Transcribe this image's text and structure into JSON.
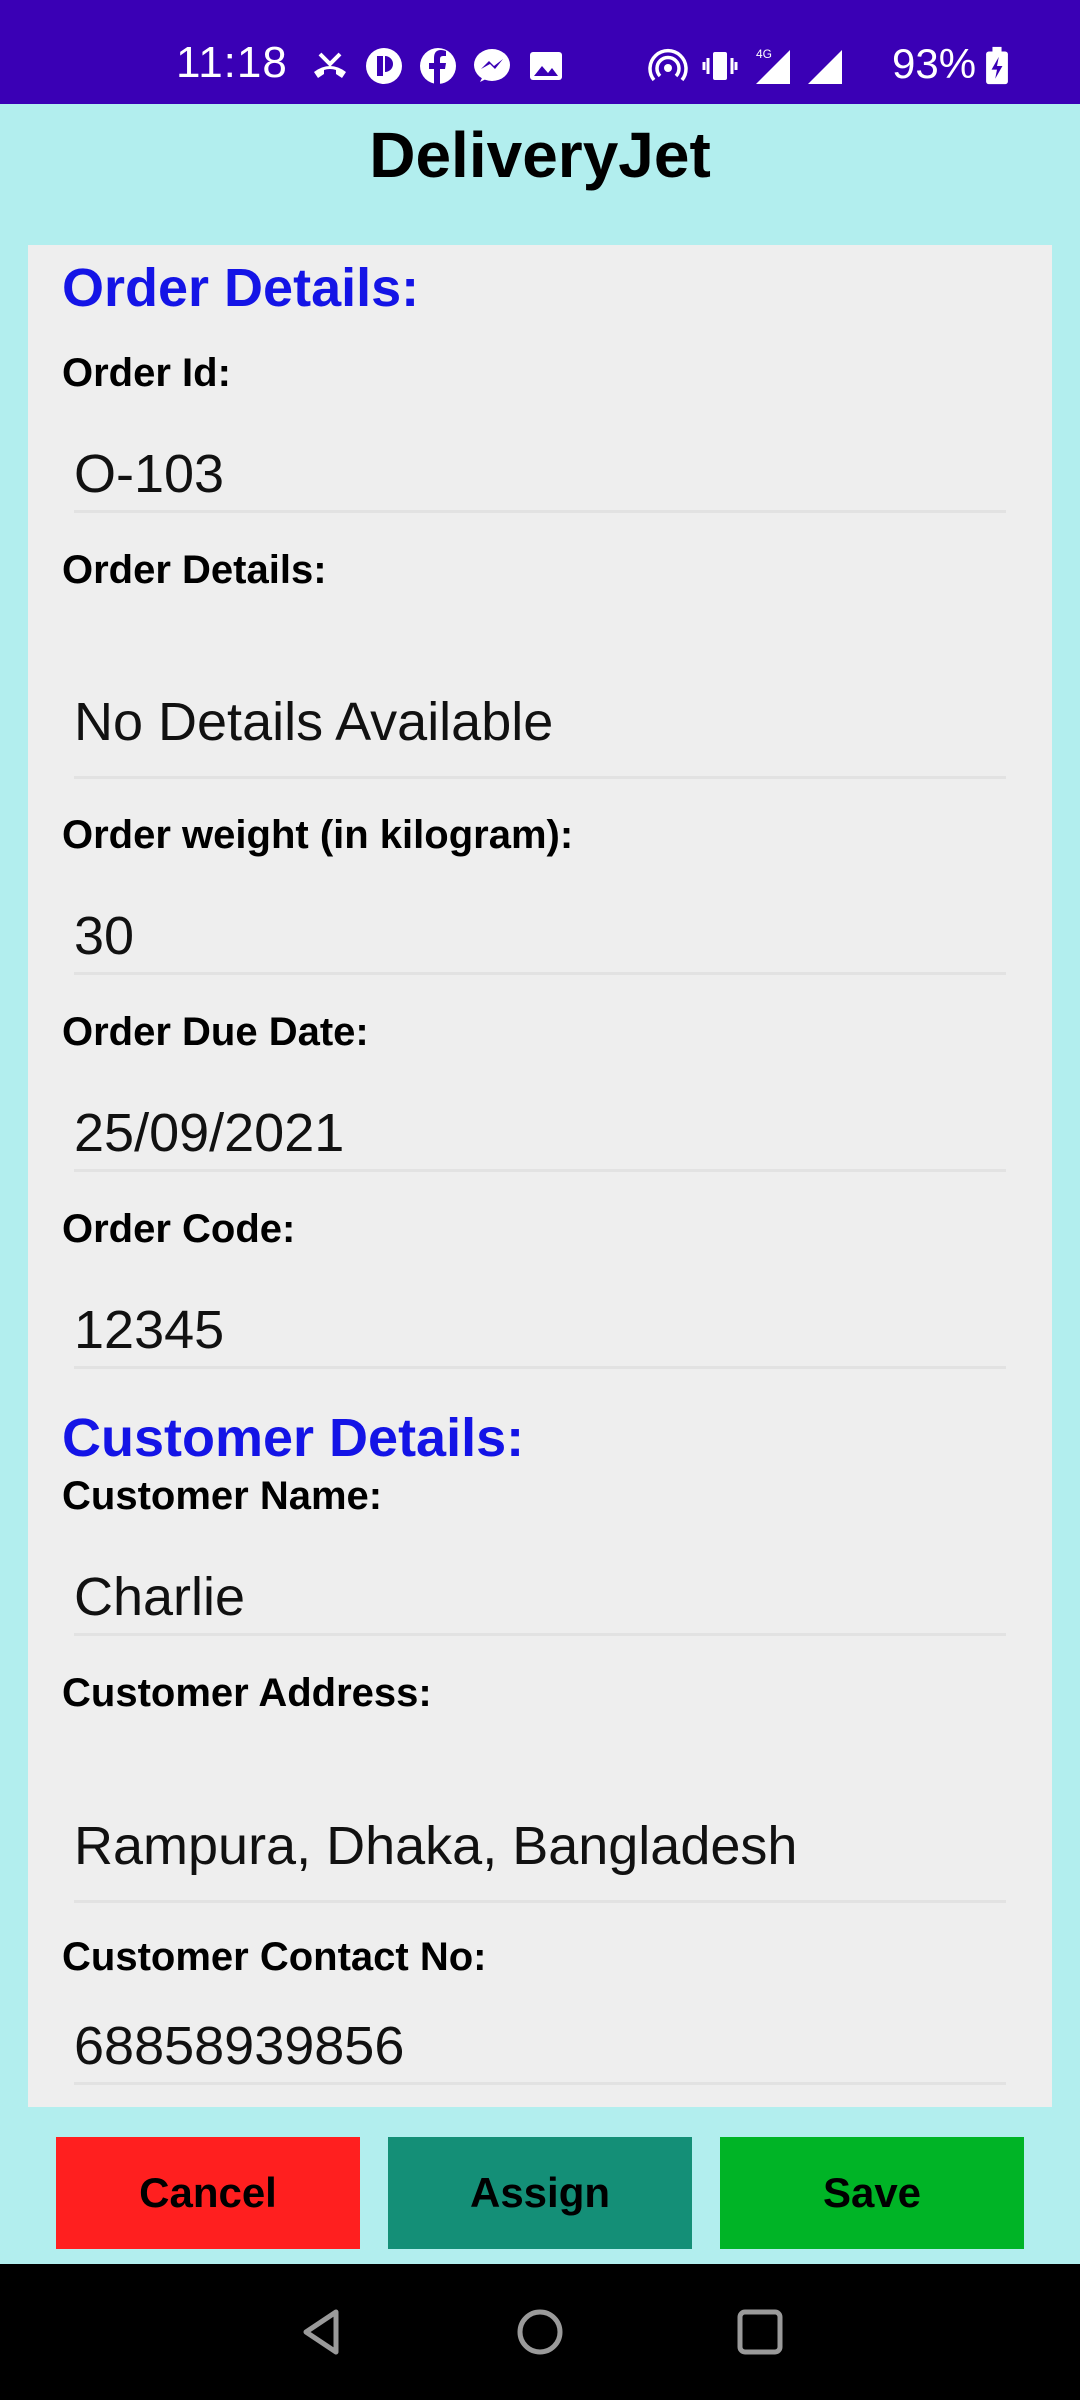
{
  "status_bar": {
    "time": "11:18",
    "battery": "93%",
    "network": "4G",
    "left_icons": [
      "missed-call-icon",
      "app-badge-icon",
      "facebook-icon",
      "messenger-icon",
      "gallery-icon"
    ],
    "right_icons": [
      "hotspot-icon",
      "vibrate-icon",
      "signal-icon",
      "signal-icon",
      "battery-charging-icon"
    ],
    "bg_color": "#3a00b5"
  },
  "app": {
    "title": "DeliveryJet",
    "bg_color": "#b2eeee"
  },
  "order_section": {
    "title": "Order Details:",
    "fields": {
      "order_id": {
        "label": "Order Id:",
        "value": "O-103"
      },
      "order_details": {
        "label": "Order Details:",
        "value": "No Details Available"
      },
      "order_weight": {
        "label": "Order weight (in kilogram):",
        "value": "30"
      },
      "due_date": {
        "label": "Order Due Date:",
        "value": "25/09/2021"
      },
      "order_code": {
        "label": "Order Code:",
        "value": "12345"
      }
    }
  },
  "customer_section": {
    "title": "Customer Details:",
    "fields": {
      "name": {
        "label": "Customer Name:",
        "value": "Charlie"
      },
      "address": {
        "label": "Customer Address:",
        "value": "Rampura, Dhaka, Bangladesh"
      },
      "contact": {
        "label": "Customer Contact No:",
        "value": "68858939856"
      }
    }
  },
  "buttons": {
    "cancel": {
      "label": "Cancel",
      "color": "#ff1f1f"
    },
    "assign": {
      "label": "Assign",
      "color": "#148f77"
    },
    "save": {
      "label": "Save",
      "color": "#00b426"
    }
  },
  "nav_bar": {
    "icons": [
      "back-icon",
      "home-icon",
      "recents-icon"
    ]
  }
}
